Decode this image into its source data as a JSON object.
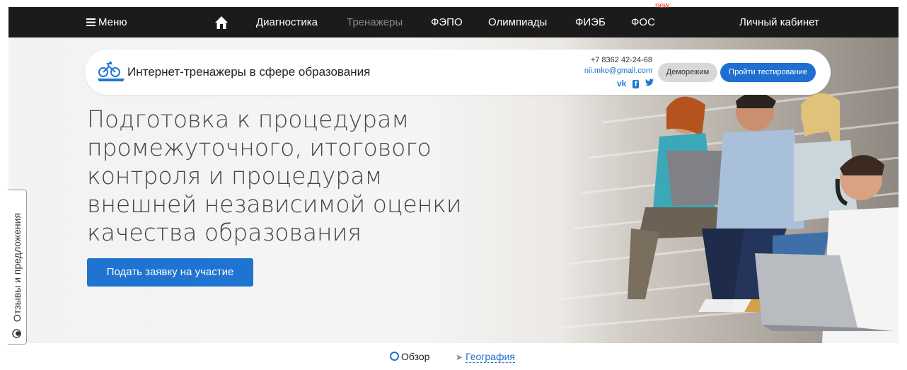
{
  "topnav": {
    "menu_label": "Меню",
    "items": [
      {
        "label": "Диагностика",
        "active": false
      },
      {
        "label": "Тренажеры",
        "active": true
      },
      {
        "label": "ФЭПО",
        "active": false
      },
      {
        "label": "Олимпиады",
        "active": false
      },
      {
        "label": "ФИЭБ",
        "active": false
      },
      {
        "label": "ФОС",
        "badge": "new",
        "active": false
      }
    ],
    "account_label": "Личный кабинет",
    "home_icon": "home-icon"
  },
  "header": {
    "site_name": "Интернет-тренажеры в сфере образования",
    "phone": "+7 8362 42-24-68",
    "email": "nii.mko@gmail.com",
    "socials": [
      "vk-icon",
      "facebook-icon",
      "twitter-icon"
    ],
    "demo_label": "Деморежим",
    "test_label": "Пройти тестирование"
  },
  "hero": {
    "headline": "Подготовка к процедурам промежуточного, итогового контроля и процедурам внешней независимой оценки качества образования",
    "apply_label": "Подать заявку на участие"
  },
  "feedback": {
    "label": "Отзывы и предложения"
  },
  "subtabs": {
    "overview": "Обзор",
    "geography": "География"
  },
  "colors": {
    "accent": "#1f6fd1",
    "nav_bg": "#1b1b1b",
    "badge": "#ff2a2a"
  }
}
